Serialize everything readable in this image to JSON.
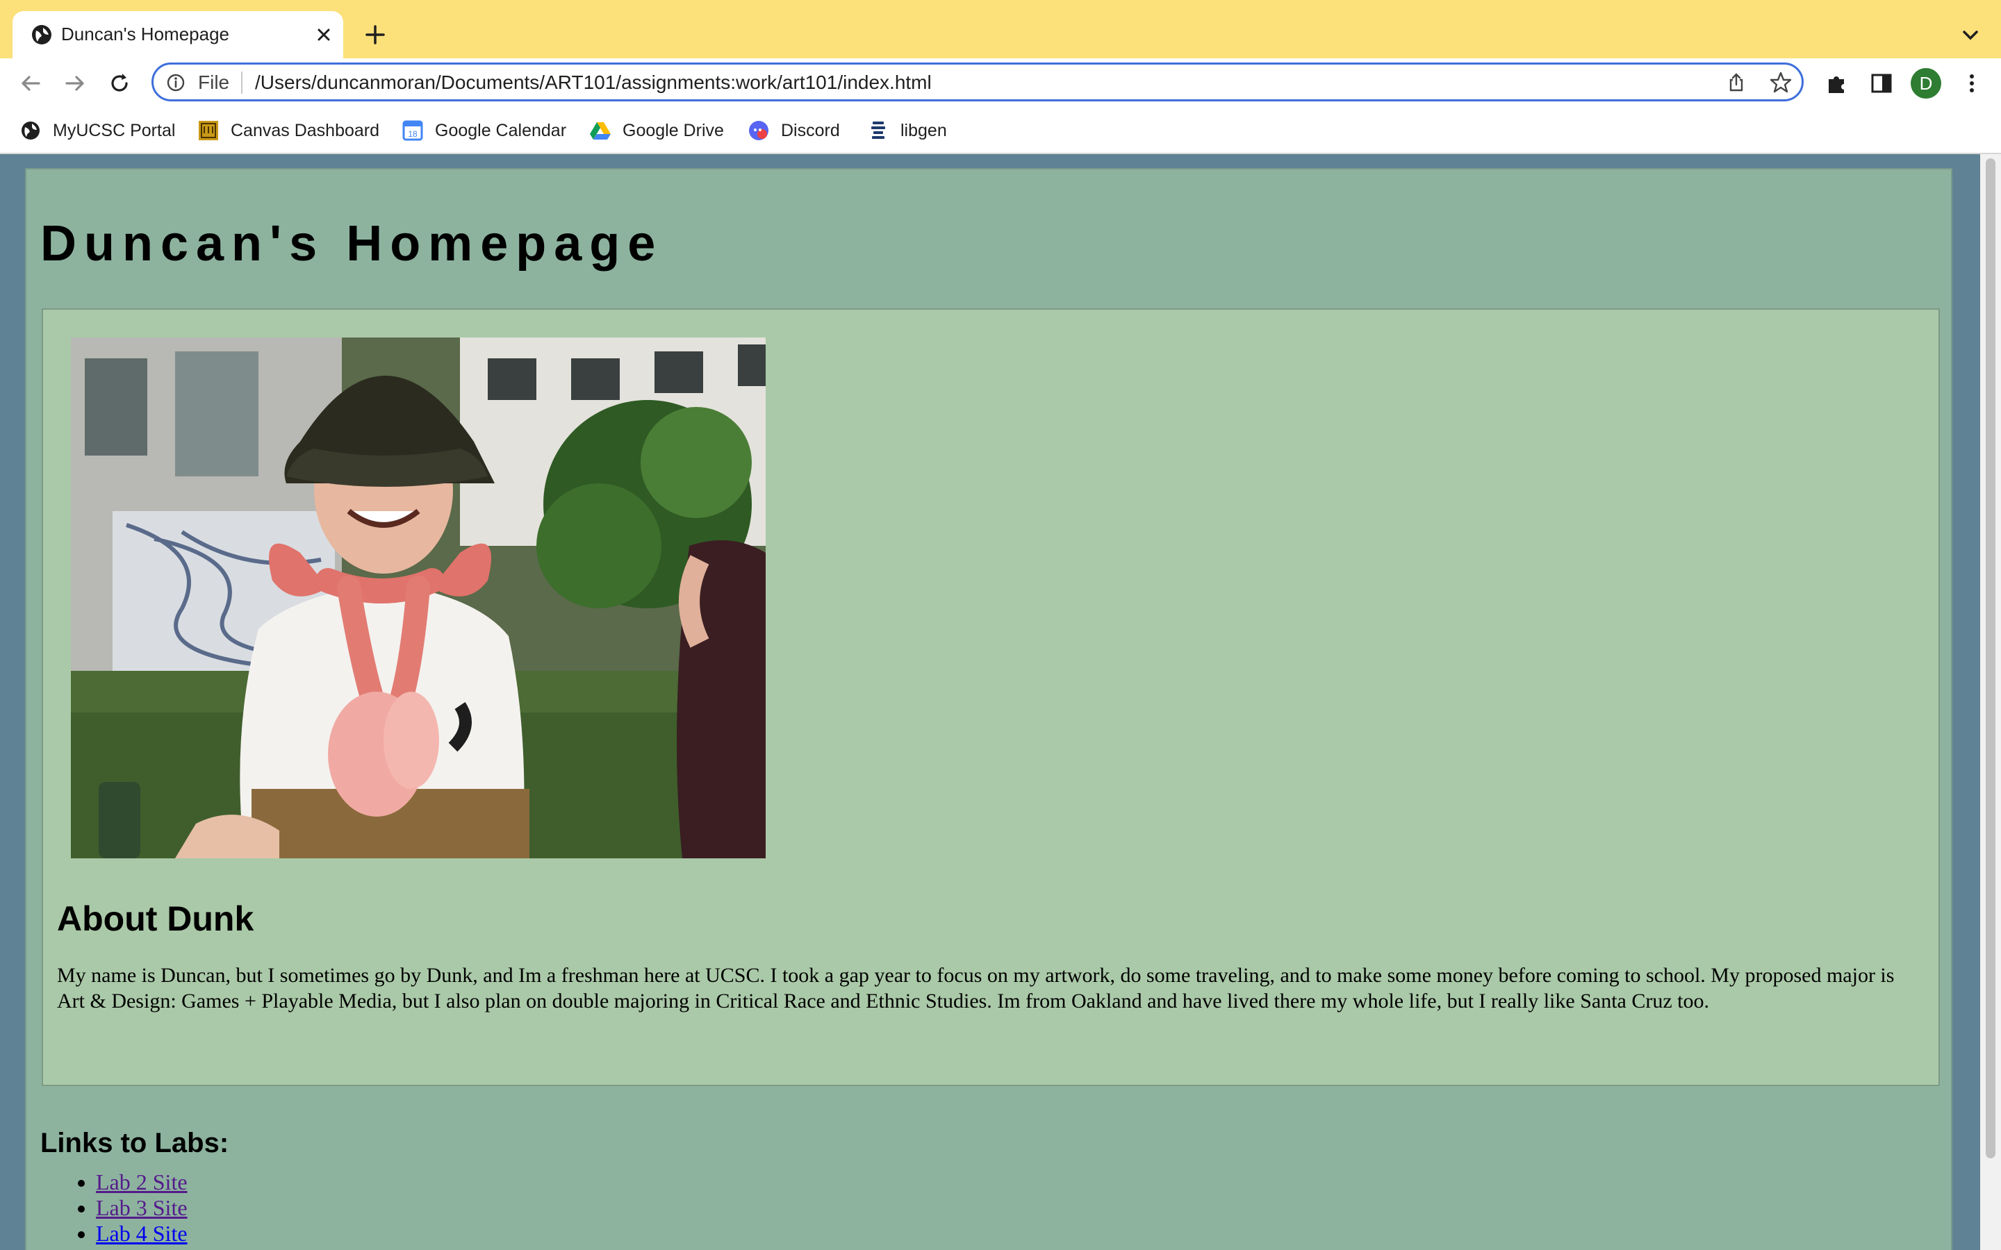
{
  "browser": {
    "tab_title": "Duncan's Homepage",
    "address_scheme_label": "File",
    "address_url": "/Users/duncanmoran/Documents/ART101/assignments:work/art101/index.html",
    "profile_initial": "D",
    "accent_color": "#3f6fdb",
    "tabbar_color": "#fce07a"
  },
  "bookmarks": [
    {
      "label": "MyUCSC Portal",
      "icon": "globe-icon"
    },
    {
      "label": "Canvas Dashboard",
      "icon": "ucsc-icon"
    },
    {
      "label": "Google Calendar",
      "icon": "calendar-icon"
    },
    {
      "label": "Google Drive",
      "icon": "drive-icon"
    },
    {
      "label": "Discord",
      "icon": "discord-icon"
    },
    {
      "label": "libgen",
      "icon": "libgen-icon"
    }
  ],
  "page": {
    "title": "Duncan's Homepage",
    "photo_icon": "portrait-photo",
    "about_heading": "About Dunk",
    "about_text": "My name is Duncan, but I sometimes go by Dunk, and Im a freshman here at UCSC. I took a gap year to focus on my artwork, do some traveling, and to make some money before coming to school. My proposed major is Art & Design: Games + Playable Media, but I also plan on double majoring in Critical Race and Ethnic Studies. Im from Oakland and have lived there my whole life, but I really like Santa Cruz too.",
    "links_heading": "Links to Labs:",
    "labs": [
      {
        "label": "Lab 2 Site"
      },
      {
        "label": "Lab 3 Site"
      },
      {
        "label": "Lab 4 Site"
      }
    ],
    "background_color": "#8db39f",
    "box_color": "#aac9a8",
    "outer_color": "#5f8294"
  }
}
